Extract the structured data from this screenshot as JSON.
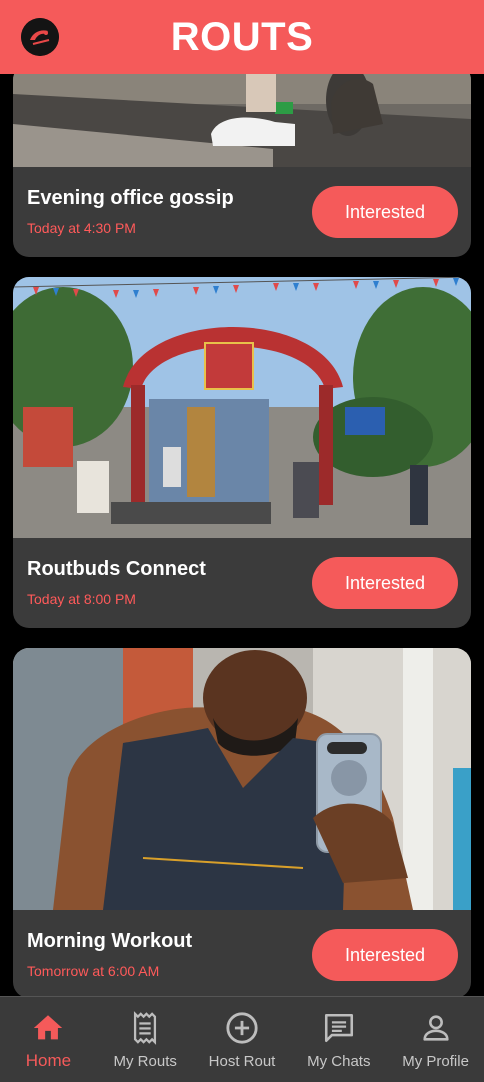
{
  "header": {
    "title": "ROUTS"
  },
  "events": [
    {
      "title": "Evening office gossip",
      "time": "Today at 4:30 PM",
      "button": "Interested"
    },
    {
      "title": "Routbuds Connect",
      "time": "Today at 8:00 PM",
      "button": "Interested"
    },
    {
      "title": "Morning Workout",
      "time": "Tomorrow at 6:00 AM",
      "button": "Interested"
    }
  ],
  "nav": [
    {
      "label": "Home",
      "icon": "home-icon",
      "active": true
    },
    {
      "label": "My Routs",
      "icon": "receipt-icon",
      "active": false
    },
    {
      "label": "Host Rout",
      "icon": "add-circle-icon",
      "active": false
    },
    {
      "label": "My Chats",
      "icon": "chat-icon",
      "active": false
    },
    {
      "label": "My Profile",
      "icon": "person-icon",
      "active": false
    }
  ],
  "colors": {
    "accent": "#f55a5a",
    "card": "#3b3b3b",
    "nav": "#3a3a3a"
  }
}
